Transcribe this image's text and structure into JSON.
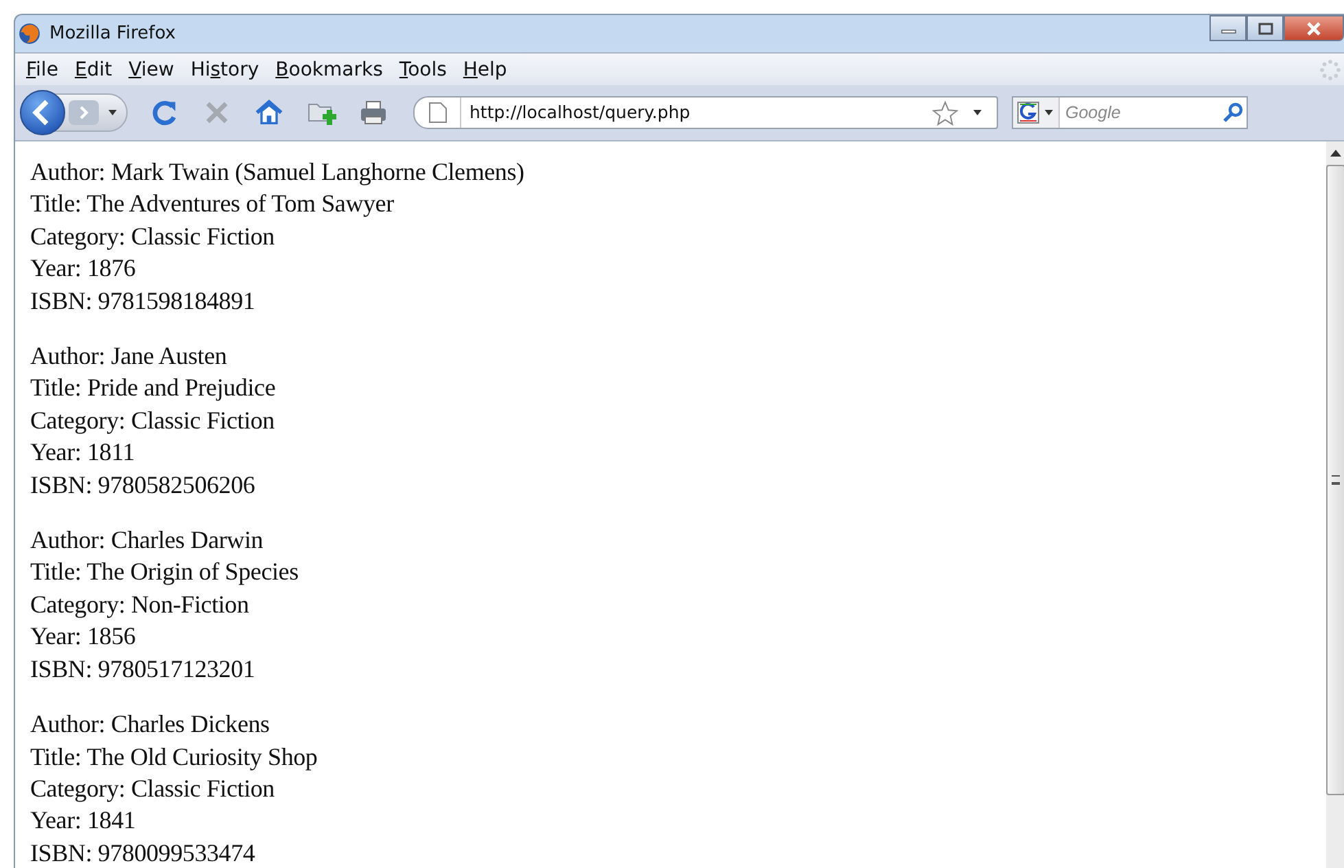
{
  "window": {
    "title": "Mozilla Firefox"
  },
  "menu": [
    {
      "key": "F",
      "post": "ile"
    },
    {
      "key": "E",
      "post": "dit"
    },
    {
      "key": "V",
      "post": "iew"
    },
    {
      "pre": "Hi",
      "key": "s",
      "post": "tory"
    },
    {
      "key": "B",
      "post": "ookmarks"
    },
    {
      "key": "T",
      "post": "ools"
    },
    {
      "key": "H",
      "post": "elp"
    }
  ],
  "address": {
    "value": "http://localhost/query.php"
  },
  "search": {
    "placeholder": "Google"
  },
  "records": [
    [
      "Author: Mark Twain (Samuel Langhorne Clemens)",
      "Title: The Adventures of Tom Sawyer",
      "Category: Classic Fiction",
      "Year: 1876",
      "ISBN: 9781598184891"
    ],
    [
      "Author: Jane Austen",
      "Title: Pride and Prejudice",
      "Category: Classic Fiction",
      "Year: 1811",
      "ISBN: 9780582506206"
    ],
    [
      "Author: Charles Darwin",
      "Title: The Origin of Species",
      "Category: Non-Fiction",
      "Year: 1856",
      "ISBN: 9780517123201"
    ],
    [
      "Author: Charles Dickens",
      "Title: The Old Curiosity Shop",
      "Category: Classic Fiction",
      "Year: 1841",
      "ISBN: 9780099533474"
    ]
  ]
}
